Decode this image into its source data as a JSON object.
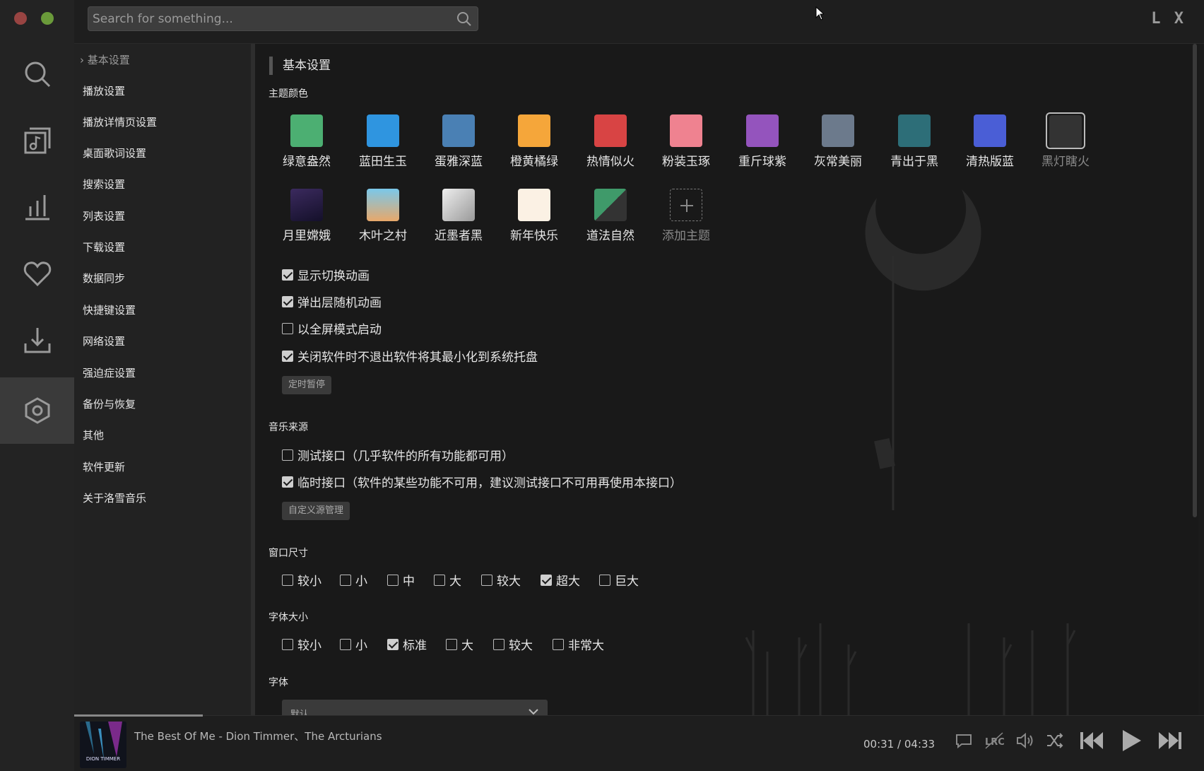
{
  "search": {
    "placeholder": "Search for something..."
  },
  "logo": "L X",
  "nav": {
    "current": "基本设置",
    "items": [
      "播放设置",
      "播放详情页设置",
      "桌面歌词设置",
      "搜索设置",
      "列表设置",
      "下载设置",
      "数据同步",
      "快捷键设置",
      "网络设置",
      "强迫症设置",
      "备份与恢复",
      "其他",
      "软件更新",
      "关于洛雪音乐"
    ]
  },
  "section": {
    "title": "基本设置"
  },
  "theme_colors": {
    "label": "主题颜色",
    "row1": [
      {
        "label": "绿意盎然",
        "color": "#4caf72"
      },
      {
        "label": "蓝田生玉",
        "color": "#2f95e0"
      },
      {
        "label": "蛋雅深蓝",
        "color": "#4a80b4"
      },
      {
        "label": "橙黄橘绿",
        "color": "#f5a63a"
      },
      {
        "label": "热情似火",
        "color": "#d84444"
      },
      {
        "label": "粉装玉琢",
        "color": "#ef8290"
      },
      {
        "label": "重斤球紫",
        "color": "#9454bd"
      },
      {
        "label": "灰常美丽",
        "color": "#6c7a8c"
      },
      {
        "label": "青出于黑",
        "color": "#2d6e78"
      },
      {
        "label": "清热版蓝",
        "color": "#4a5ed6"
      },
      {
        "label": "黑灯瞎火",
        "color": "#333333"
      }
    ],
    "row2": [
      {
        "label": "月里嫦娥",
        "color": "#2a1c44"
      },
      {
        "label": "木叶之村",
        "color": "#7ac8ea"
      },
      {
        "label": "近墨者黑",
        "color": "#d8d8d8"
      },
      {
        "label": "新年快乐",
        "color": "#fbf1e4"
      },
      {
        "label": "道法自然",
        "color": "#3f9a6a"
      }
    ],
    "add_label": "添加主题"
  },
  "options": {
    "show_switch_anim": {
      "label": "显示切换动画",
      "checked": true
    },
    "popup_random_anim": {
      "label": "弹出层随机动画",
      "checked": true
    },
    "fullscreen_start": {
      "label": "以全屏模式启动",
      "checked": false
    },
    "minimize_tray": {
      "label": "关闭软件时不退出软件将其最小化到系统托盘",
      "checked": true
    },
    "timer_button": "定时暂停"
  },
  "music_source": {
    "label": "音乐来源",
    "test_api": {
      "label": "测试接口（几乎软件的所有功能都可用）",
      "checked": false
    },
    "temp_api": {
      "label": "临时接口（软件的某些功能不可用，建议测试接口不可用再使用本接口）",
      "checked": true
    },
    "custom_button": "自定义源管理"
  },
  "window_size": {
    "label": "窗口尺寸",
    "options": [
      "较小",
      "小",
      "中",
      "大",
      "较大",
      "超大",
      "巨大"
    ],
    "selected": "超大"
  },
  "font_size": {
    "label": "字体大小",
    "options": [
      "较小",
      "小",
      "标准",
      "大",
      "较大",
      "非常大"
    ],
    "selected": "标准"
  },
  "font": {
    "label": "字体",
    "value": "默认"
  },
  "player": {
    "title": "The Best Of Me - Dion Timmer、The Arcturians",
    "current": "00:31",
    "separator": "/",
    "duration": "04:33",
    "cover_text": "DION TIMMER",
    "progress": 0.114
  },
  "colors": {
    "dot_red": "#c0504d",
    "dot_green": "#6a9a3a"
  }
}
